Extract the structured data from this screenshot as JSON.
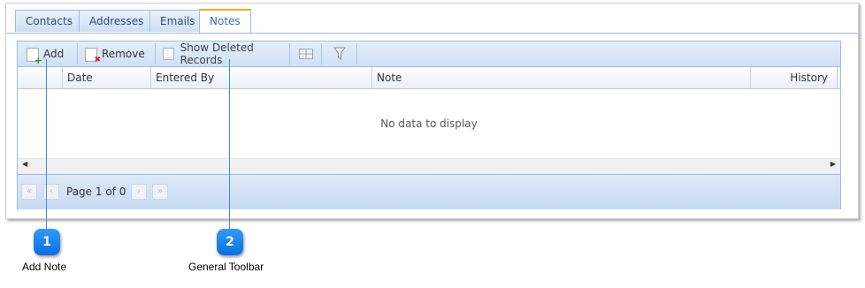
{
  "tabs": [
    {
      "label": "Contacts"
    },
    {
      "label": "Addresses"
    },
    {
      "label": "Emails"
    },
    {
      "label": "Notes"
    }
  ],
  "toolbar": {
    "add_label": "Add",
    "remove_label": "Remove",
    "show_deleted_label": "Show Deleted Records"
  },
  "columns": [
    "Date",
    "Entered By",
    "Note",
    "History"
  ],
  "empty_text": "No data to display",
  "pager": {
    "page_text": "Page 1 of 0"
  },
  "callouts": [
    {
      "number": "1",
      "caption": "Add Note"
    },
    {
      "number": "2",
      "caption": "General Toolbar"
    }
  ],
  "colors": {
    "accent": "#3e6aaa",
    "callout": "#0a6fe0",
    "active_tab_top": "#f5a623"
  }
}
